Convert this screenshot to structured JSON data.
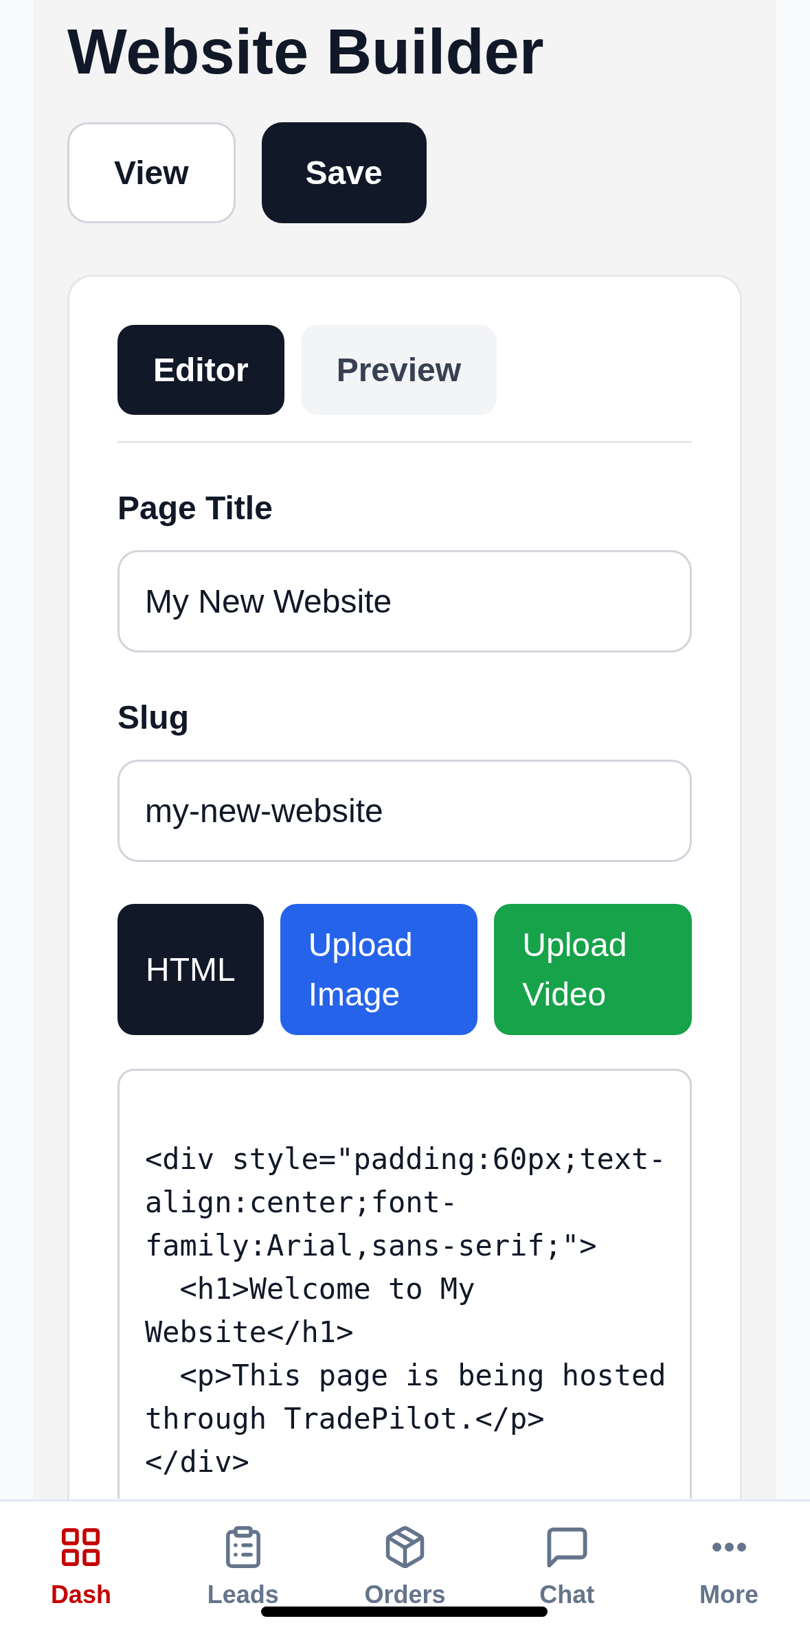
{
  "header": {
    "title": "Website Builder",
    "buttons": [
      {
        "label": "View",
        "kind": "outline"
      },
      {
        "label": "Save",
        "kind": "primary"
      }
    ]
  },
  "editor": {
    "tabs": [
      {
        "label": "Editor",
        "selected": true
      },
      {
        "label": "Preview",
        "selected": false
      }
    ],
    "fields": [
      {
        "label": "Page Title",
        "value": "My New Website"
      },
      {
        "label": "Slug",
        "value": "my-new-website"
      }
    ],
    "tools": [
      {
        "label": "HTML",
        "kind": "html"
      },
      {
        "label": "Upload Image",
        "kind": "image"
      },
      {
        "label": "Upload Video",
        "kind": "video"
      }
    ],
    "code": {
      "value": "<div style=\"padding:60px;text-align:center;font-family:Arial,sans-serif;\">\n  <h1>Welcome to My Website</h1>\n  <p>This page is being hosted through TradePilot.</p>\n</div>"
    }
  },
  "bottom_nav": [
    {
      "label": "Dash",
      "selected": true
    },
    {
      "label": "Leads",
      "selected": false
    },
    {
      "label": "Orders",
      "selected": false
    },
    {
      "label": "Chat",
      "selected": false
    },
    {
      "label": "More",
      "selected": false
    }
  ]
}
